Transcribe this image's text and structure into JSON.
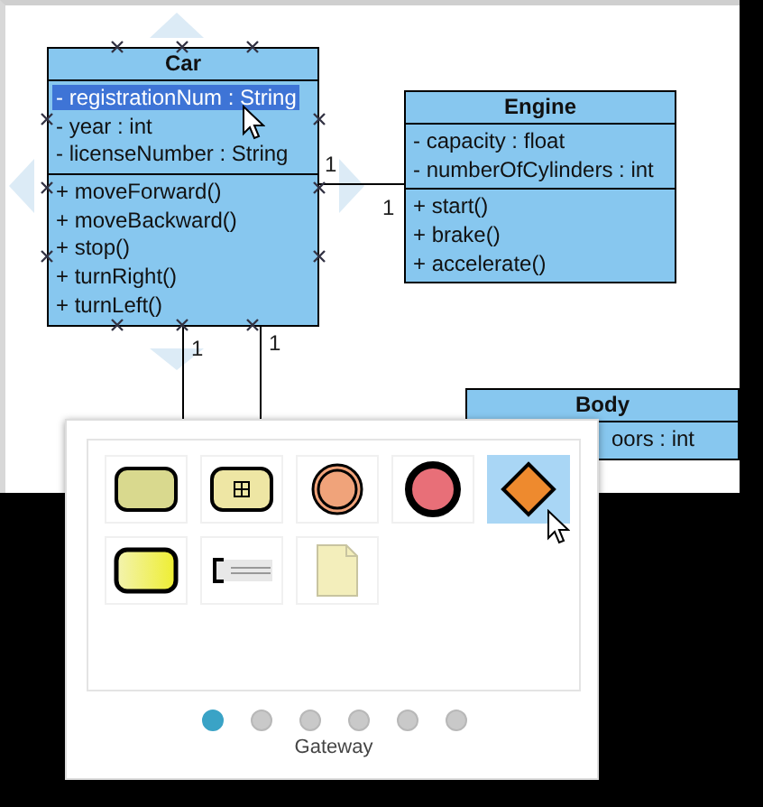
{
  "classes": [
    {
      "name": "Car",
      "attributes": [
        {
          "text": "- registrationNum : String",
          "selected": true
        },
        {
          "text": "- year : int",
          "selected": false
        },
        {
          "text": "- licenseNumber : String",
          "selected": false
        }
      ],
      "methods": [
        "+ moveForward()",
        "+ moveBackward()",
        "+ stop()",
        "+ turnRight()",
        "+ turnLeft()"
      ]
    },
    {
      "name": "Engine",
      "attributes": [
        {
          "text": "- capacity : float",
          "selected": false
        },
        {
          "text": "- numberOfCylinders : int",
          "selected": false
        }
      ],
      "methods": [
        "+ start()",
        "+ brake()",
        "+ accelerate()"
      ]
    },
    {
      "name": "Body",
      "attributes": [
        {
          "text": "oors : int",
          "selected": false
        }
      ]
    }
  ],
  "associations": [
    {
      "labels": [
        "1",
        "1"
      ]
    },
    {
      "labels": [
        "1"
      ]
    },
    {
      "labels": [
        "1"
      ]
    }
  ],
  "palette": {
    "items": [
      {
        "kind": "task",
        "selected": false
      },
      {
        "kind": "sub-process",
        "selected": false
      },
      {
        "kind": "intermediate-event",
        "selected": false
      },
      {
        "kind": "end-event",
        "selected": false
      },
      {
        "kind": "gateway",
        "selected": true
      },
      {
        "kind": "call-activity",
        "selected": false
      },
      {
        "kind": "text-annotation",
        "selected": false
      },
      {
        "kind": "data-object",
        "selected": false
      }
    ],
    "pages": [
      {
        "selected": true
      },
      {
        "selected": false
      },
      {
        "selected": false
      },
      {
        "selected": false
      },
      {
        "selected": false
      },
      {
        "selected": false
      }
    ],
    "caption": "Gateway"
  }
}
